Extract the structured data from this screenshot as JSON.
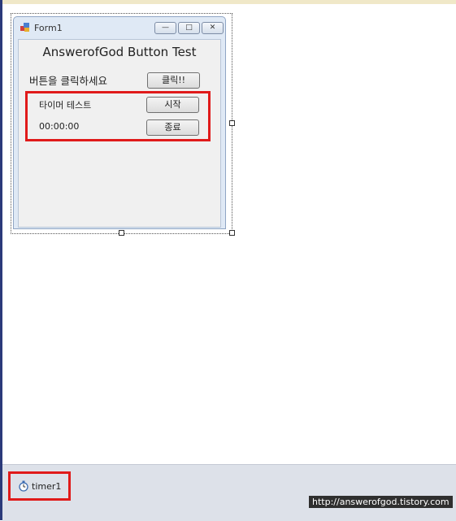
{
  "form": {
    "title": "Form1",
    "minimize_glyph": "—",
    "maximize_glyph": "□",
    "close_glyph": "✕"
  },
  "heading": "AnswerofGod Button Test",
  "row1": {
    "label": "버튼을 클릭하세요",
    "button": "클릭!!"
  },
  "timer_section": {
    "label": "타이머 테스트",
    "start_button": "시작",
    "time_display": "00:00:00",
    "stop_button": "종료"
  },
  "component_tray": {
    "items": [
      {
        "label": "timer1",
        "icon": "stopwatch-icon"
      }
    ]
  },
  "watermark": "http://answerofgod.tistory.com",
  "colors": {
    "highlight": "#e01a1a",
    "tray": "#dde1e9"
  }
}
